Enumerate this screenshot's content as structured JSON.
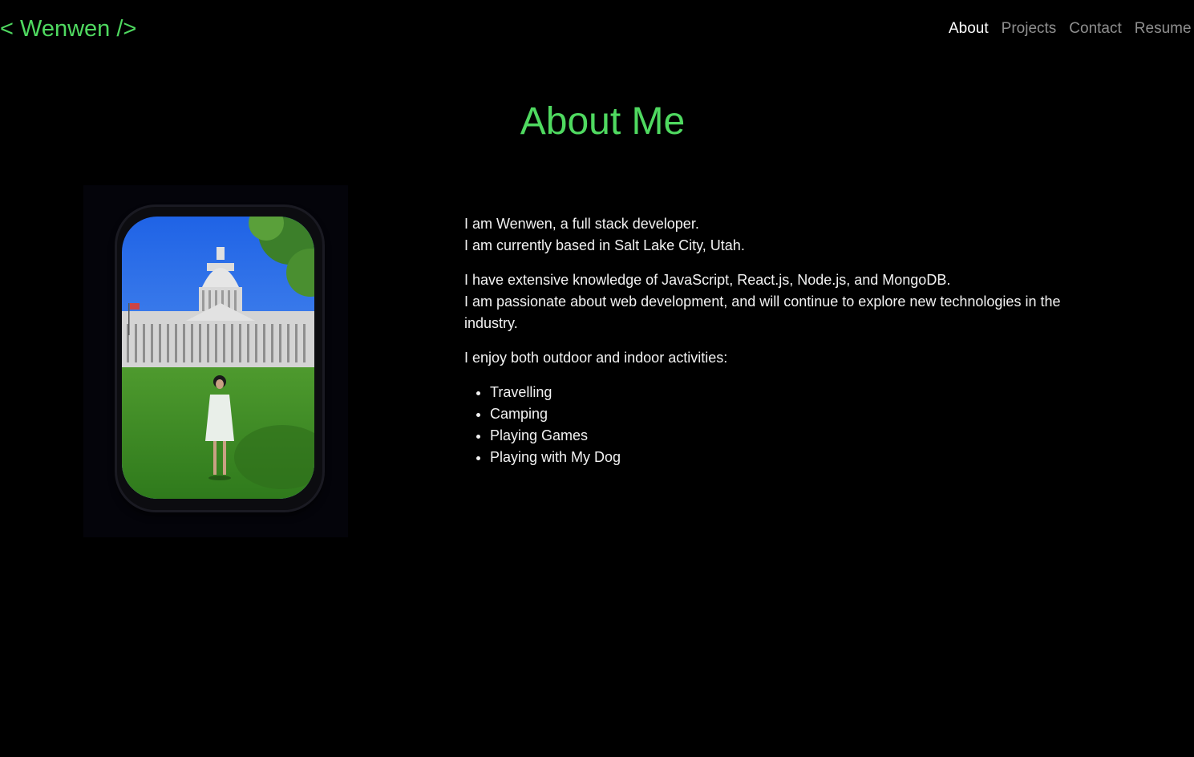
{
  "brand": {
    "text": "< Wenwen />"
  },
  "nav": {
    "items": [
      {
        "label": "About"
      },
      {
        "label": "Projects"
      },
      {
        "label": "Contact"
      },
      {
        "label": "Resume"
      }
    ],
    "active": "About"
  },
  "colors": {
    "accent": "#4fd960",
    "background": "#000000",
    "nav_inactive": "#8f8f8f",
    "text": "#f2f2f2"
  },
  "page": {
    "title": "About Me"
  },
  "photo": {
    "icon": "profile-photo"
  },
  "intro": {
    "line1": "I am Wenwen, a full stack developer.",
    "line2": "I am currently based in Salt Lake City, Utah."
  },
  "skills": {
    "line1": "I have extensive knowledge of JavaScript, React.js, Node.js, and MongoDB.",
    "line2": "I am passionate about web development, and will continue to explore new technologies in the industry."
  },
  "activities": {
    "heading": "I enjoy both outdoor and indoor activities:",
    "items": [
      "Travelling",
      "Camping",
      "Playing Games",
      "Playing with My Dog"
    ]
  }
}
